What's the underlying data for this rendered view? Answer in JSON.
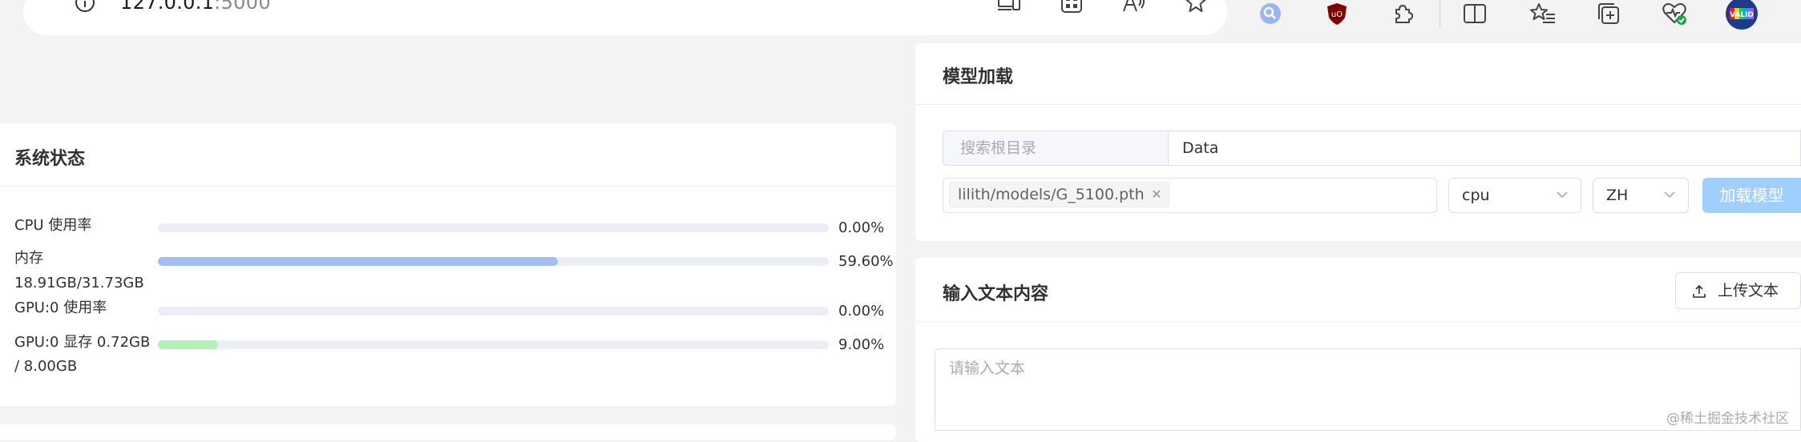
{
  "browser": {
    "url_host": "127.0.0.1",
    "url_port": ":5000",
    "avatar_text": "VALID",
    "icons": [
      "info-icon",
      "devices-icon",
      "qr-apps-icon",
      "read-aloud-icon",
      "favorite-star-icon",
      "search-extension-icon",
      "ublock-icon",
      "extensions-icon",
      "split-screen-icon",
      "favorites-icon",
      "collections-icon",
      "browser-essentials-icon",
      "profile-avatar-icon"
    ]
  },
  "system_status": {
    "title": "系统状态",
    "rows": [
      {
        "label": "CPU 使用率",
        "label2": "",
        "percent_text": "0.00%",
        "fill": 0.0,
        "color": "#a0cfff"
      },
      {
        "label": "内存",
        "label2": "18.91GB/31.73GB",
        "percent_text": "59.60%",
        "fill": 0.596,
        "color": "#a0bff5"
      },
      {
        "label": "GPU:0 使用率",
        "label2": "",
        "percent_text": "0.00%",
        "fill": 0.0,
        "color": "#a0cfff"
      },
      {
        "label": "GPU:0 显存 0.72GB",
        "label2": "/ 8.00GB",
        "percent_text": "9.00%",
        "fill": 0.09,
        "color": "#b3f0b3"
      }
    ]
  },
  "model_load": {
    "title": "模型加载",
    "search_root_placeholder": "搜索根目录",
    "search_root_value": "Data",
    "selected_model_tag": "lilith/models/G_5100.pth",
    "device_value": "cpu",
    "language_value": "ZH",
    "load_button_label": "加载模型"
  },
  "text_input": {
    "title": "输入文本内容",
    "upload_button_label": "上传文本",
    "textarea_placeholder": "请输入文本"
  },
  "watermark": "@稀土掘金技术社区"
}
